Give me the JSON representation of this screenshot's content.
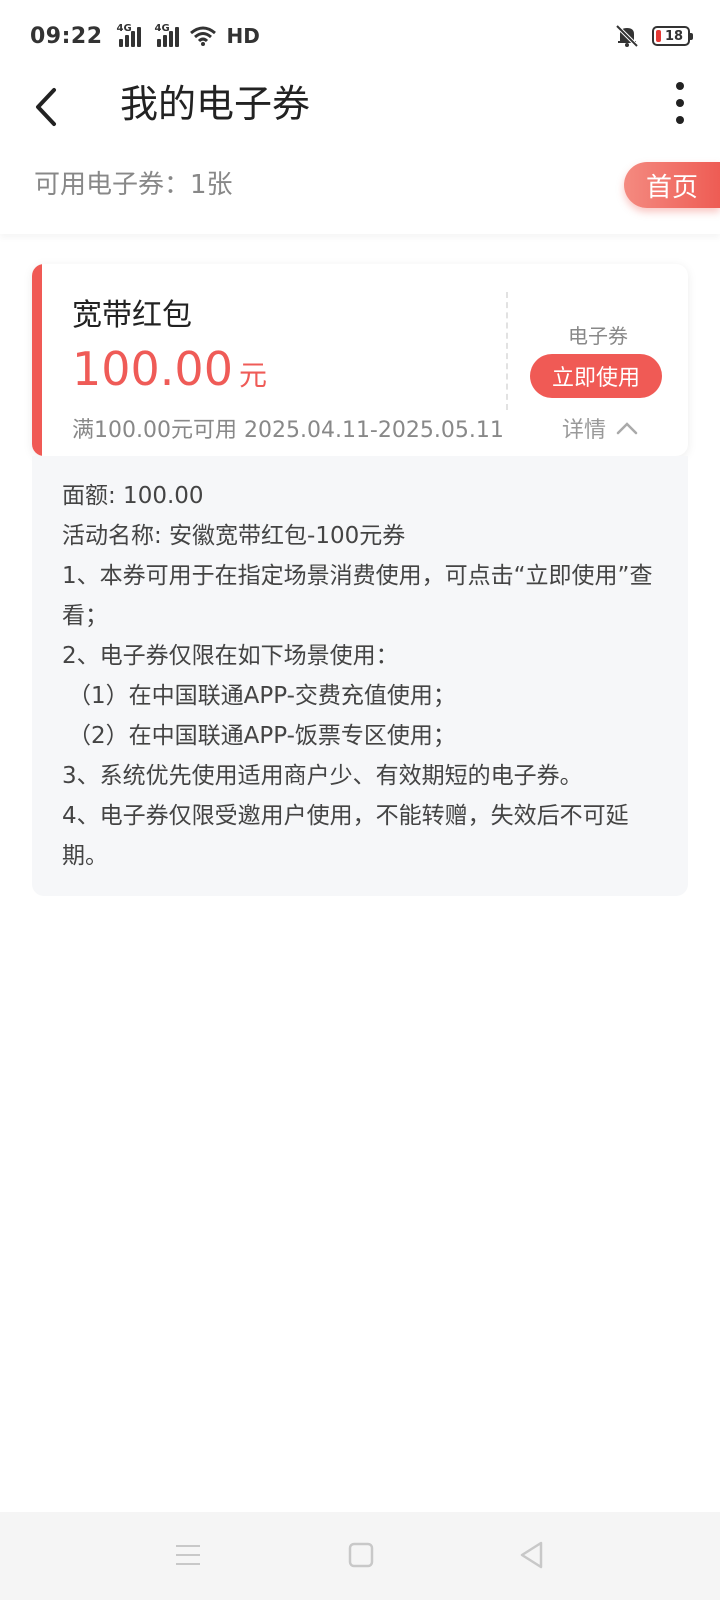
{
  "status_bar": {
    "time": "09:22",
    "network1": "4G",
    "network2": "4G",
    "hd": "HD",
    "battery": "18"
  },
  "header": {
    "title": "我的电子券"
  },
  "summary": {
    "count_text": "可用电子券：1张",
    "home_label": "首页"
  },
  "coupon": {
    "name": "宽带红包",
    "amount": "100.00",
    "unit": "元",
    "condition": "满100.00元可用 2025.04.11-2025.05.11",
    "type": "电子券",
    "use_label": "立即使用",
    "details_label": "详情"
  },
  "details": {
    "lines": [
      "面额: 100.00",
      "活动名称: 安徽宽带红包-100元券",
      "1、本券可用于在指定场景消费使用，可点击“立即使用”查看；",
      "2、电子券仅限在如下场景使用：",
      "（1）在中国联通APP-交费充值使用；",
      "（2）在中国联通APP-饭票专区使用；",
      "3、系统优先使用适用商户少、有效期短的电子券。",
      "4、电子券仅限受邀用户使用，不能转赠，失效后不可延期。"
    ]
  },
  "icons": {
    "back": "chevron-left-icon",
    "more": "more-vertical-icon",
    "details": "chevron-up-icon",
    "nav": [
      "menu-icon",
      "square-icon",
      "triangle-back-icon"
    ]
  },
  "colors": {
    "accent": "#f05a55",
    "home_gradient_start": "#f48a80",
    "home_gradient_end": "#ee5c54"
  }
}
